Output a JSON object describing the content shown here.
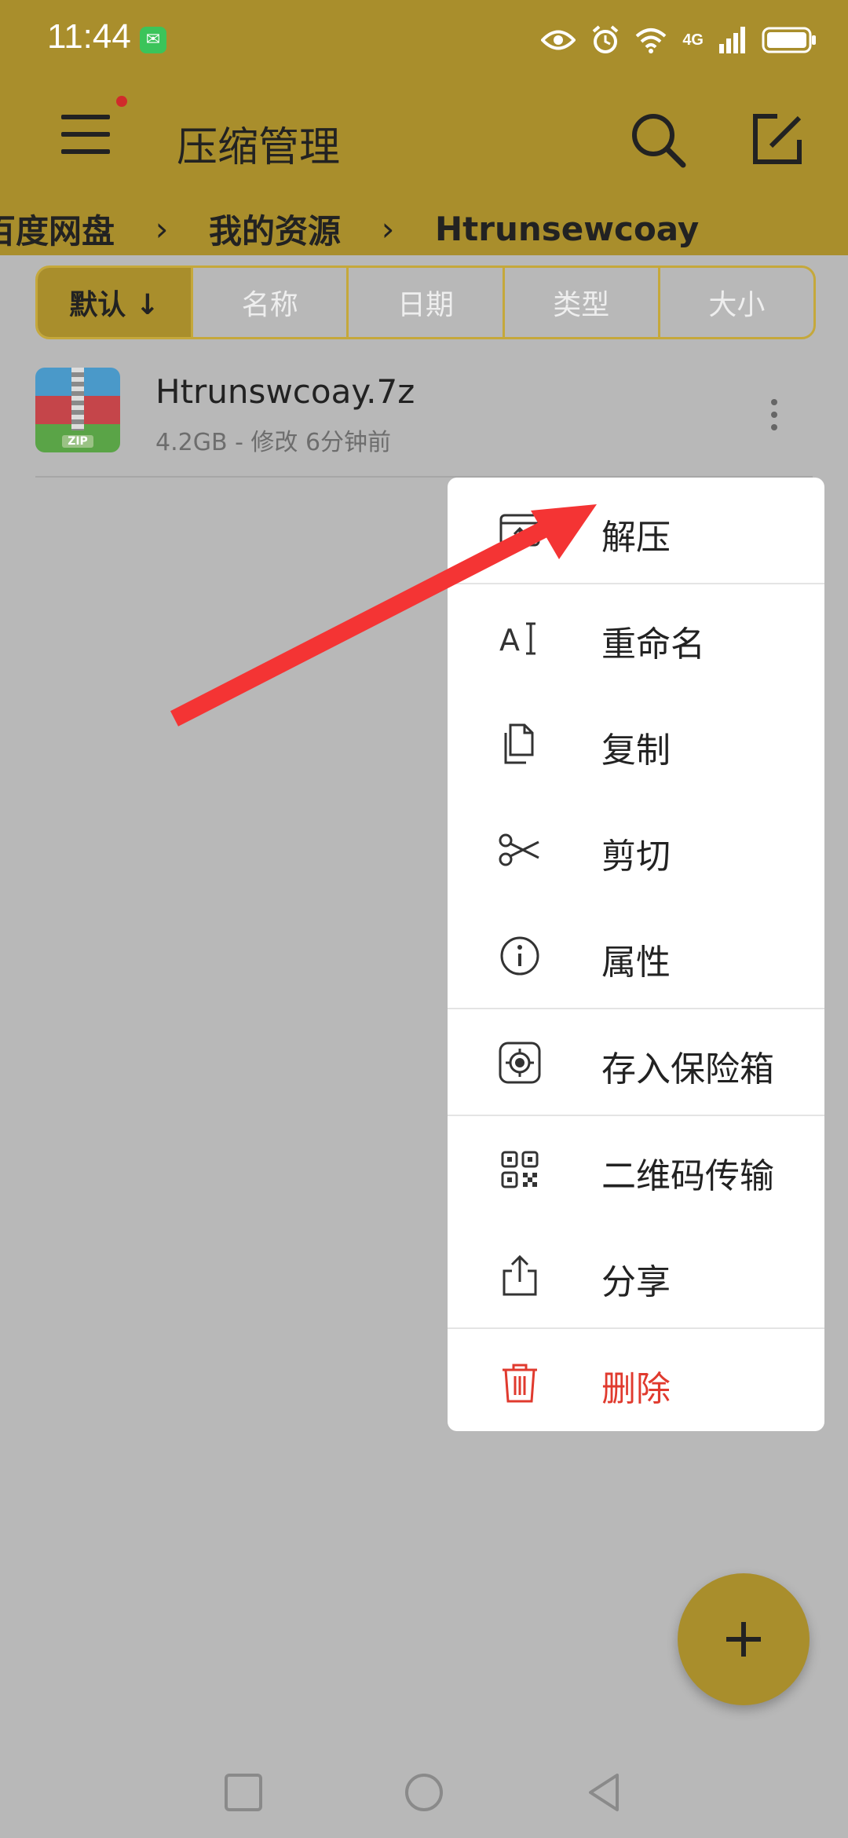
{
  "status_bar": {
    "time": "11:44",
    "network": "4G"
  },
  "app_bar": {
    "title": "压缩管理",
    "icons": [
      "menu-icon",
      "search-icon",
      "edit-icon"
    ]
  },
  "breadcrumb": [
    "百度网盘",
    "我的资源",
    "Htrunsewcoay"
  ],
  "sort_tabs": [
    {
      "label": "默认 ↓",
      "active": true
    },
    {
      "label": "名称",
      "active": false
    },
    {
      "label": "日期",
      "active": false
    },
    {
      "label": "类型",
      "active": false
    },
    {
      "label": "大小",
      "active": false
    }
  ],
  "file": {
    "name": "Htrunswcoay.7z",
    "meta": "4.2GB - 修改 6分钟前",
    "icon_tag": "ZIP"
  },
  "context_menu": [
    {
      "label": "解压",
      "icon": "extract-icon"
    },
    {
      "label": "重命名",
      "icon": "rename-icon"
    },
    {
      "label": "复制",
      "icon": "copy-icon"
    },
    {
      "label": "剪切",
      "icon": "cut-icon"
    },
    {
      "label": "属性",
      "icon": "info-icon"
    },
    {
      "label": "存入保险箱",
      "icon": "safe-icon"
    },
    {
      "label": "二维码传输",
      "icon": "qrcode-icon"
    },
    {
      "label": "分享",
      "icon": "share-icon"
    },
    {
      "label": "删除",
      "icon": "delete-icon"
    }
  ],
  "colors": {
    "accent": "#a98e2c",
    "danger": "#e03a2e",
    "annotation_arrow": "#f43434"
  }
}
